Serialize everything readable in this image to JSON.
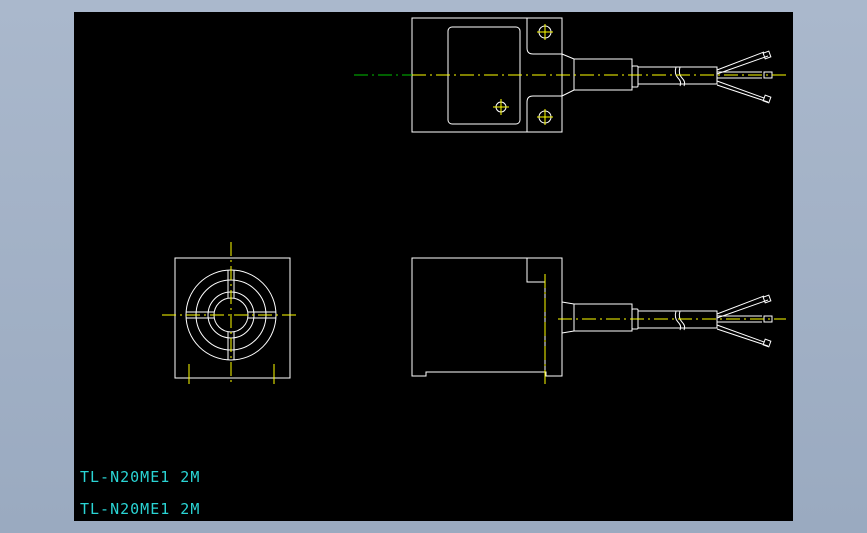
{
  "background_color": "#a5b3c7",
  "viewport_color": "#000000",
  "stroke_color": "#ffffff",
  "centerline_color": "#ffff00",
  "axis_green_color": "#00c000",
  "text_color": "#2ad4d4",
  "labels": [
    "TL-N20ME1 2M",
    "TL-N20ME1 2M"
  ]
}
